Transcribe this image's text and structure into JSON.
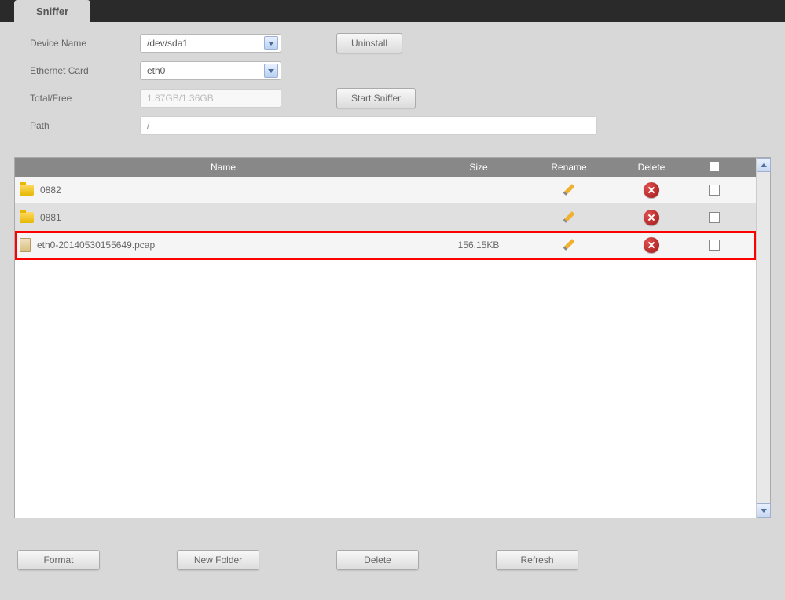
{
  "tab": {
    "label": "Sniffer"
  },
  "form": {
    "device_name_label": "Device Name",
    "device_name_value": "/dev/sda1",
    "ethernet_card_label": "Ethernet Card",
    "ethernet_card_value": "eth0",
    "total_free_label": "Total/Free",
    "total_free_value": "1.87GB/1.36GB",
    "path_label": "Path",
    "path_value": "/"
  },
  "buttons": {
    "uninstall": "Uninstall",
    "start_sniffer": "Start Sniffer",
    "format": "Format",
    "new_folder": "New Folder",
    "delete": "Delete",
    "refresh": "Refresh"
  },
  "table": {
    "headers": {
      "name": "Name",
      "size": "Size",
      "rename": "Rename",
      "delete": "Delete"
    },
    "rows": [
      {
        "name": "0882",
        "size": "",
        "type": "folder",
        "highlighted": false
      },
      {
        "name": "0881",
        "size": "",
        "type": "folder",
        "highlighted": false
      },
      {
        "name": "eth0-20140530155649.pcap",
        "size": "156.15KB",
        "type": "file",
        "highlighted": true
      }
    ]
  }
}
